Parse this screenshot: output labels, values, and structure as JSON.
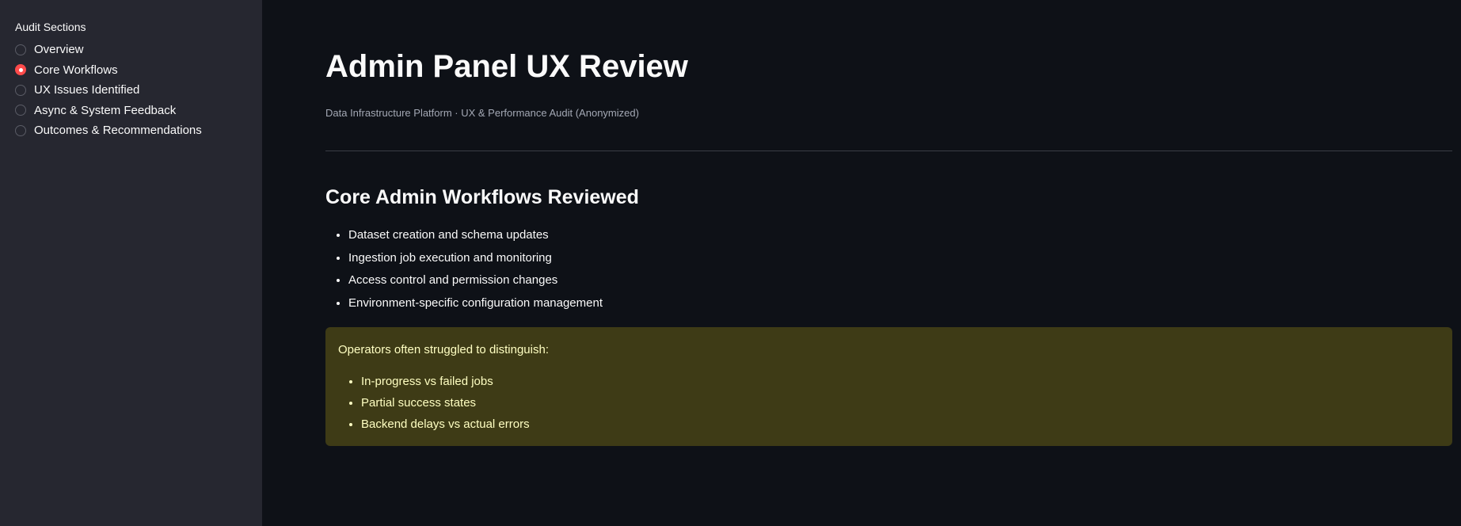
{
  "sidebar": {
    "heading": "Audit Sections",
    "selected_index": 1,
    "items": [
      {
        "label": "Overview",
        "selected": false
      },
      {
        "label": "Core Workflows",
        "selected": true
      },
      {
        "label": "UX Issues Identified",
        "selected": false
      },
      {
        "label": "Async & System Feedback",
        "selected": false
      },
      {
        "label": "Outcomes & Recommendations",
        "selected": false
      }
    ]
  },
  "main": {
    "title": "Admin Panel UX Review",
    "caption": "Data Infrastructure Platform · UX & Performance Audit (Anonymized)",
    "section_title": "Core Admin Workflows Reviewed",
    "workflows": [
      "Dataset creation and schema updates",
      "Ingestion job execution and monitoring",
      "Access control and permission changes",
      "Environment-specific configuration management"
    ],
    "callout": {
      "text": "Operators often struggled to distinguish:",
      "items": [
        "In-progress vs failed jobs",
        "Partial success states",
        "Backend delays vs actual errors"
      ]
    }
  },
  "colors": {
    "background": "#0e1117",
    "sidebar": "#262730",
    "accent": "#ff4b4b",
    "callout_bg": "#3e3b16",
    "callout_text": "#ffffc2"
  }
}
